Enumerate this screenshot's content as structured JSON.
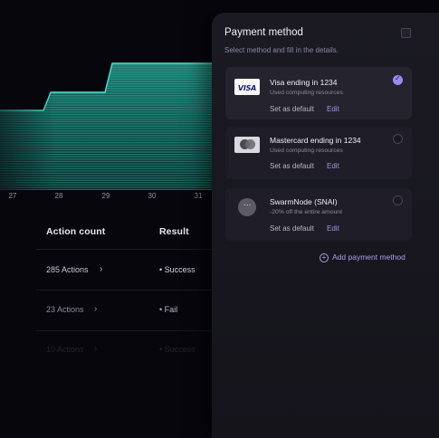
{
  "chart": {
    "ticks": [
      "27",
      "28",
      "29",
      "30",
      "31"
    ],
    "accent": "#3fd6c2"
  },
  "table": {
    "headers": [
      "Action count",
      "Result"
    ],
    "rows": [
      {
        "count": "285 Actions",
        "result": "Success"
      },
      {
        "count": "23 Actions",
        "result": "Fail"
      },
      {
        "count": "10 Actions",
        "result": "Success"
      }
    ]
  },
  "payment": {
    "title": "Payment method",
    "subtitle": "Select method and fill in the details.",
    "options": [
      {
        "brand": "VISA",
        "title": "Visa ending in 1234",
        "sub": "Used computing resources",
        "default_label": "Set as default",
        "edit_label": "Edit",
        "selected": true,
        "icon": "visa-card-icon"
      },
      {
        "title": "Mastercard ending in 1234",
        "sub": "Used computing resources",
        "default_label": "Set as default",
        "edit_label": "Edit",
        "selected": false,
        "icon": "mastercard-card-icon"
      },
      {
        "title": "SwarmNode (SNAI)",
        "sub": "-20% off the entire amount",
        "default_label": "Set as default",
        "edit_label": "Edit",
        "selected": false,
        "icon": "more-dots-icon"
      }
    ],
    "add_label": "Add payment method",
    "link_color": "#9f95e6"
  }
}
